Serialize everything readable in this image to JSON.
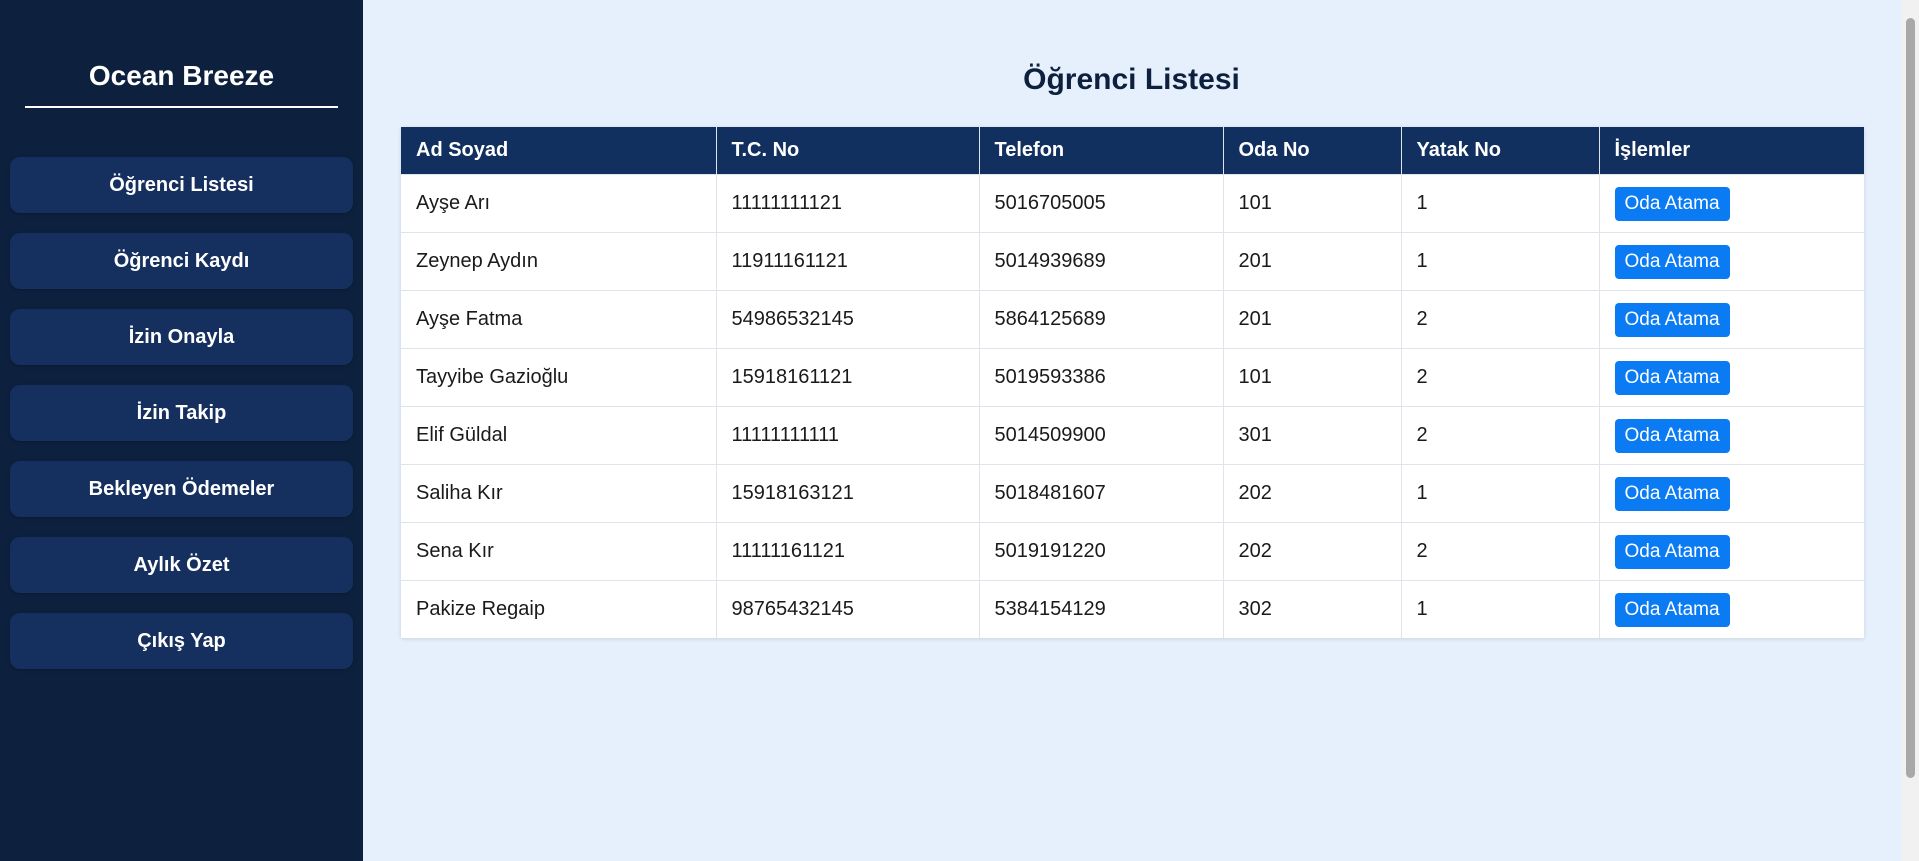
{
  "sidebar": {
    "brand": "Ocean Breeze",
    "items": [
      {
        "label": "Öğrenci Listesi"
      },
      {
        "label": "Öğrenci Kaydı"
      },
      {
        "label": "İzin Onayla"
      },
      {
        "label": "İzin Takip"
      },
      {
        "label": "Bekleyen Ödemeler"
      },
      {
        "label": "Aylık Özet"
      },
      {
        "label": "Çıkış Yap"
      }
    ]
  },
  "main": {
    "title": "Öğrenci Listesi",
    "table": {
      "headers": [
        "Ad Soyad",
        "T.C. No",
        "Telefon",
        "Oda No",
        "Yatak No",
        "İşlemler"
      ],
      "rows": [
        {
          "name": "Ayşe Arı",
          "tc": "11111111121",
          "phone": "5016705005",
          "room": "101",
          "bed": "1",
          "action": "Oda Atama"
        },
        {
          "name": "Zeynep Aydın",
          "tc": "11911161121",
          "phone": "5014939689",
          "room": "201",
          "bed": "1",
          "action": "Oda Atama"
        },
        {
          "name": "Ayşe Fatma",
          "tc": "54986532145",
          "phone": "5864125689",
          "room": "201",
          "bed": "2",
          "action": "Oda Atama"
        },
        {
          "name": "Tayyibe Gazioğlu",
          "tc": "15918161121",
          "phone": "5019593386",
          "room": "101",
          "bed": "2",
          "action": "Oda Atama"
        },
        {
          "name": "Elif Güldal",
          "tc": "11111111111",
          "phone": "5014509900",
          "room": "301",
          "bed": "2",
          "action": "Oda Atama"
        },
        {
          "name": "Saliha Kır",
          "tc": "15918163121",
          "phone": "5018481607",
          "room": "202",
          "bed": "1",
          "action": "Oda Atama"
        },
        {
          "name": "Sena Kır",
          "tc": "11111161121",
          "phone": "5019191220",
          "room": "202",
          "bed": "2",
          "action": "Oda Atama"
        },
        {
          "name": "Pakize Regaip",
          "tc": "98765432145",
          "phone": "5384154129",
          "room": "302",
          "bed": "1",
          "action": "Oda Atama"
        }
      ]
    }
  },
  "colors": {
    "sidebar_bg": "#0d213f",
    "nav_item_bg": "#15305f",
    "header_bg": "#12305f",
    "page_bg": "#e6f0fc",
    "button_bg": "#0a7bf3"
  }
}
